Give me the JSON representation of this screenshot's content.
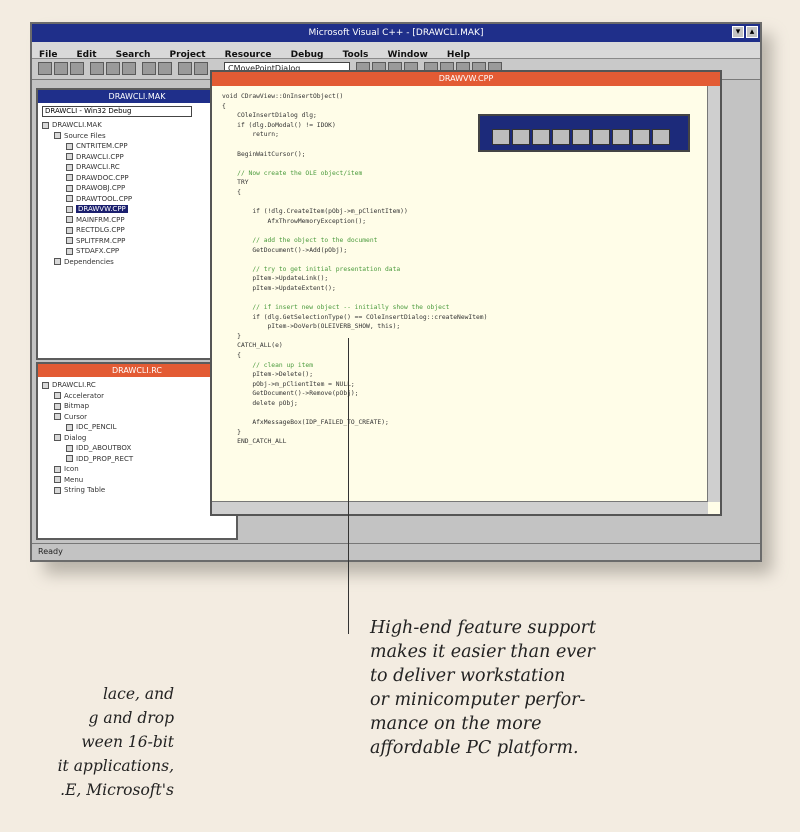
{
  "window": {
    "title": "Microsoft Visual C++ - [DRAWCLI.MAK]"
  },
  "menu": [
    "File",
    "Edit",
    "Search",
    "Project",
    "Resource",
    "Debug",
    "Tools",
    "Window",
    "Help"
  ],
  "toolbar": {
    "combo_value": "CMovePointDialog"
  },
  "project_pane": {
    "title": "DRAWCLI.MAK",
    "combo_value": "DRAWCLI - Win32 Debug",
    "items": [
      {
        "label": "DRAWCLI.MAK",
        "depth": 0
      },
      {
        "label": "Source Files",
        "depth": 1
      },
      {
        "label": "CNTRITEM.CPP",
        "depth": 2
      },
      {
        "label": "DRAWCLI.CPP",
        "depth": 2
      },
      {
        "label": "DRAWCLI.RC",
        "depth": 2
      },
      {
        "label": "DRAWDOC.CPP",
        "depth": 2
      },
      {
        "label": "DRAWOBJ.CPP",
        "depth": 2
      },
      {
        "label": "DRAWTOOL.CPP",
        "depth": 2
      },
      {
        "label": "DRAWVW.CPP",
        "depth": 2,
        "selected": true
      },
      {
        "label": "MAINFRM.CPP",
        "depth": 2
      },
      {
        "label": "RECTDLG.CPP",
        "depth": 2
      },
      {
        "label": "SPLITFRM.CPP",
        "depth": 2
      },
      {
        "label": "STDAFX.CPP",
        "depth": 2
      },
      {
        "label": "Dependencies",
        "depth": 1
      }
    ]
  },
  "resource_pane": {
    "title": "DRAWCLI.RC",
    "items": [
      {
        "label": "DRAWCLI.RC",
        "depth": 0
      },
      {
        "label": "Accelerator",
        "depth": 1
      },
      {
        "label": "Bitmap",
        "depth": 1
      },
      {
        "label": "Cursor",
        "depth": 1
      },
      {
        "label": "IDC_PENCIL",
        "depth": 2
      },
      {
        "label": "Dialog",
        "depth": 1
      },
      {
        "label": "IDD_ABOUTBOX",
        "depth": 2
      },
      {
        "label": "IDD_PROP_RECT",
        "depth": 2
      },
      {
        "label": "Icon",
        "depth": 1
      },
      {
        "label": "Menu",
        "depth": 1
      },
      {
        "label": "String Table",
        "depth": 1
      }
    ]
  },
  "editor": {
    "title": "DRAWVW.CPP",
    "code_lines": [
      {
        "text": "void CDrawView::OnInsertObject()",
        "comment": false
      },
      {
        "text": "{",
        "comment": false
      },
      {
        "text": "    COleInsertDialog dlg;",
        "comment": false
      },
      {
        "text": "    if (dlg.DoModal() != IDOK)",
        "comment": false
      },
      {
        "text": "        return;",
        "comment": false
      },
      {
        "text": "",
        "comment": false
      },
      {
        "text": "    BeginWaitCursor();",
        "comment": false
      },
      {
        "text": "",
        "comment": false
      },
      {
        "text": "    // Now create the OLE object/item",
        "comment": true
      },
      {
        "text": "    TRY",
        "comment": false
      },
      {
        "text": "    {",
        "comment": false
      },
      {
        "text": "",
        "comment": false
      },
      {
        "text": "        if (!dlg.CreateItem(pObj->m_pClientItem))",
        "comment": false
      },
      {
        "text": "            AfxThrowMemoryException();",
        "comment": false
      },
      {
        "text": "",
        "comment": false
      },
      {
        "text": "        // add the object to the document",
        "comment": true
      },
      {
        "text": "        GetDocument()->Add(pObj);",
        "comment": false
      },
      {
        "text": "",
        "comment": false
      },
      {
        "text": "        // try to get initial presentation data",
        "comment": true
      },
      {
        "text": "        pItem->UpdateLink();",
        "comment": false
      },
      {
        "text": "        pItem->UpdateExtent();",
        "comment": false
      },
      {
        "text": "",
        "comment": false
      },
      {
        "text": "        // if insert new object -- initially show the object",
        "comment": true
      },
      {
        "text": "        if (dlg.GetSelectionType() == COleInsertDialog::createNewItem)",
        "comment": false
      },
      {
        "text": "            pItem->DoVerb(OLEIVERB_SHOW, this);",
        "comment": false
      },
      {
        "text": "    }",
        "comment": false
      },
      {
        "text": "    CATCH_ALL(e)",
        "comment": false
      },
      {
        "text": "    {",
        "comment": false
      },
      {
        "text": "        // clean up item",
        "comment": true
      },
      {
        "text": "        pItem->Delete();",
        "comment": false
      },
      {
        "text": "        pObj->m_pClientItem = NULL;",
        "comment": false
      },
      {
        "text": "        GetDocument()->Remove(pObj);",
        "comment": false
      },
      {
        "text": "        delete pObj;",
        "comment": false
      },
      {
        "text": "",
        "comment": false
      },
      {
        "text": "        AfxMessageBox(IDP_FAILED_TO_CREATE);",
        "comment": false
      },
      {
        "text": "    }",
        "comment": false
      },
      {
        "text": "    END_CATCH_ALL",
        "comment": false
      }
    ]
  },
  "status": {
    "text": "Ready"
  },
  "caption_right": [
    "High-end feature support",
    "makes it easier than ever",
    "to deliver workstation",
    "or minicomputer perfor-",
    "mance on the more",
    "affordable PC platform."
  ],
  "caption_left": [
    "lace, and",
    "g and drop",
    "ween 16-bit",
    "it applications,",
    ".E, Microsoft's"
  ]
}
